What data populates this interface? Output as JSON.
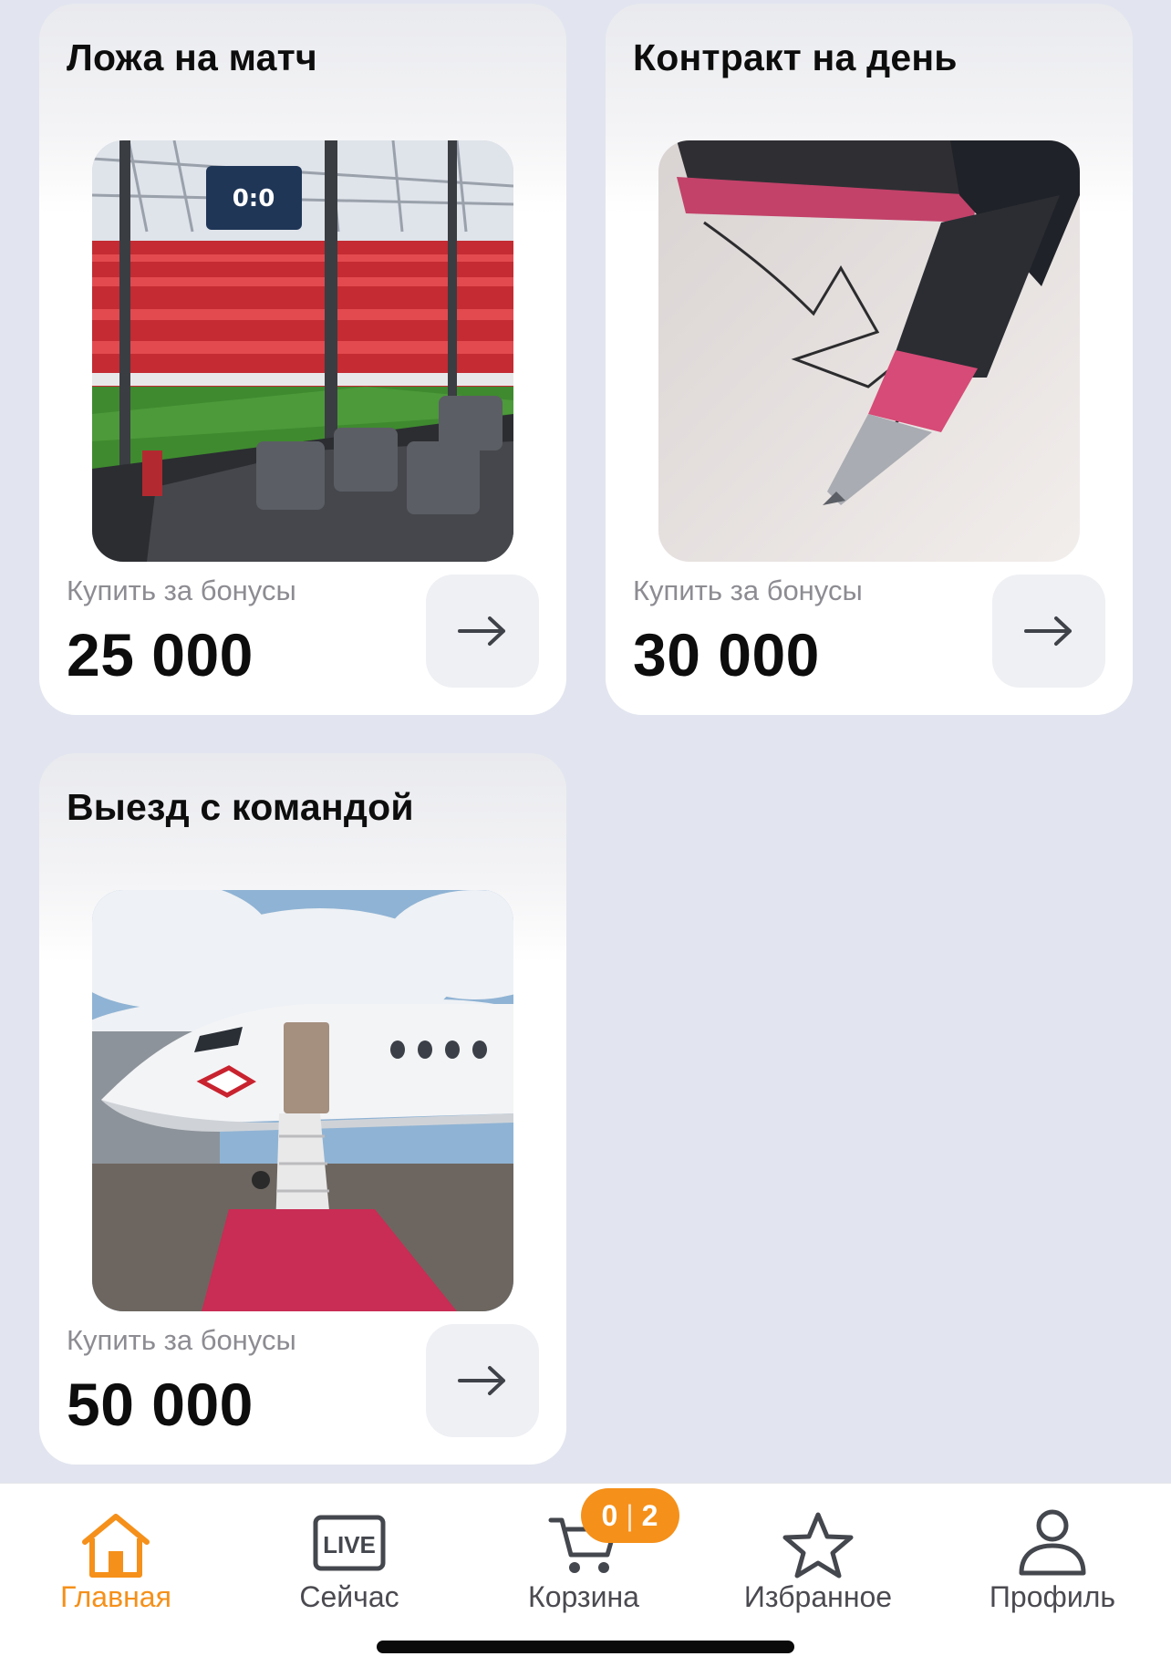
{
  "cards": [
    {
      "title": "Ложа на матч",
      "subtitle": "Купить за бонусы",
      "price": "25 000",
      "image": "stadium-box-photo"
    },
    {
      "title": "Контракт на день",
      "subtitle": "Купить за бонусы",
      "price": "30 000",
      "image": "fountain-pen-signature-photo"
    },
    {
      "title": "Выезд с командой",
      "subtitle": "Купить за бонусы",
      "price": "50 000",
      "image": "team-jet-photo"
    }
  ],
  "stadium_scoreboard": "0:0",
  "tabbar": {
    "items": [
      {
        "label": "Главная",
        "icon": "home-icon",
        "active": true
      },
      {
        "label": "Сейчас",
        "icon": "live-icon",
        "active": false
      },
      {
        "label": "Корзина",
        "icon": "cart-icon",
        "active": false
      },
      {
        "label": "Избранное",
        "icon": "star-icon",
        "active": false
      },
      {
        "label": "Профиль",
        "icon": "profile-icon",
        "active": false
      }
    ],
    "live_icon_text": "LIVE",
    "cart_badge": {
      "left": "0",
      "right": "2"
    }
  },
  "colors": {
    "accent": "#f5901a",
    "background": "#e2e5ef",
    "card": "#ffffff"
  }
}
